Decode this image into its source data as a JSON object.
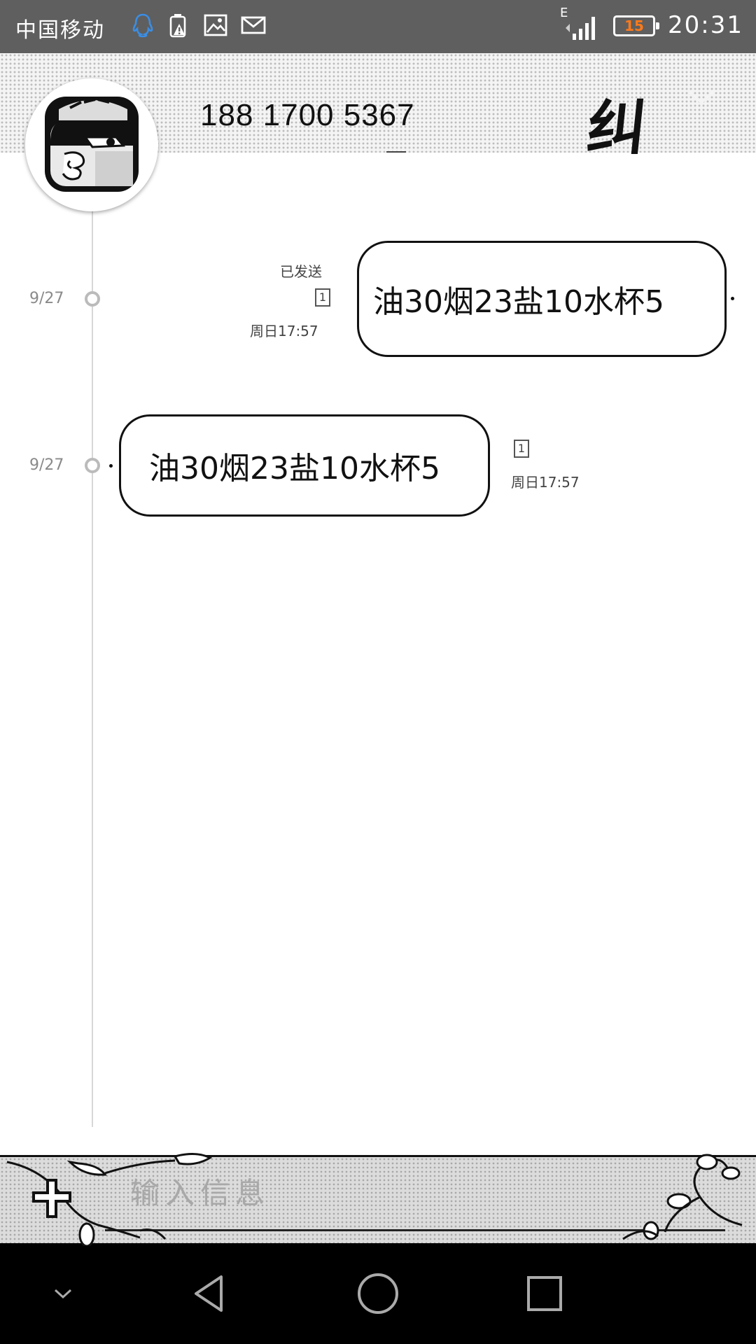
{
  "status_bar": {
    "carrier": "中国移动",
    "network_type": "E",
    "battery_level": "15",
    "time": "20:31",
    "icons": [
      "qq-icon",
      "battery-warning-icon",
      "image-icon",
      "mail-icon",
      "signal-icon",
      "battery-icon"
    ]
  },
  "header": {
    "phone_number": "188  1700  5367",
    "contact_tag": "纠",
    "avatar_icon": "cartoon-avatar-icon",
    "menu_icon": "chevron-down-icon"
  },
  "messages": [
    {
      "direction": "sent",
      "date": "9/27",
      "status": "已发送",
      "sim": "1",
      "time": "周日17:57",
      "text": "油30烟23盐10水杯5"
    },
    {
      "direction": "received",
      "date": "9/27",
      "sim": "1",
      "time": "周日17:57",
      "text": "油30烟23盐10水杯5"
    }
  ],
  "composer": {
    "placeholder": "输入信息",
    "add_icon": "plus-icon"
  },
  "nav_bar": {
    "icons": [
      "chevron-down-icon",
      "back-icon",
      "home-icon",
      "recents-icon"
    ]
  },
  "colors": {
    "status_bar_bg": "#5f5f5f",
    "battery_text": "#ff7a1a",
    "nav_bar_bg": "#000000"
  }
}
